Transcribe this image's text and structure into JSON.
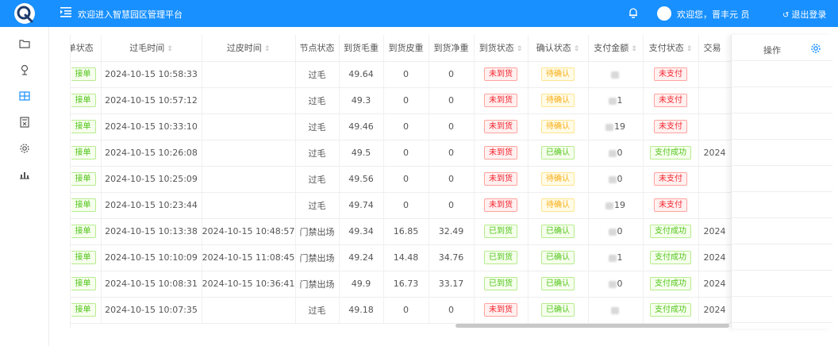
{
  "header": {
    "title": "欢迎进入智慧园区管理平台",
    "welcome": "欢迎您，晋丰元     员",
    "logout": "退出登录"
  },
  "sidebar": {
    "items": [
      {
        "icon": "folder-icon"
      },
      {
        "icon": "pin-icon"
      },
      {
        "icon": "panel-icon"
      },
      {
        "icon": "calculator-icon"
      },
      {
        "icon": "gear-icon"
      },
      {
        "icon": "chart-icon"
      }
    ]
  },
  "table": {
    "headers": {
      "order_status": "单状态",
      "gross_time": "过毛时间",
      "tare_time": "过皮时间",
      "node_status": "节点状态",
      "arrival_gross": "到货毛重",
      "arrival_tare": "到货皮重",
      "arrival_net": "到货净重",
      "arrival_status": "到货状态",
      "confirm_status": "确认状态",
      "pay_amount": "支付金额",
      "pay_status": "支付状态",
      "trade": "交易",
      "operation": "操作"
    },
    "rows": [
      {
        "order": "接单",
        "gross_time": "2024-10-15 10:58:33",
        "tare_time": "",
        "node": "过毛",
        "gross": "49.64",
        "tare": "0",
        "net": "0",
        "arrival": "未到货",
        "arrival_color": "red",
        "confirm": "待确认",
        "confirm_color": "yellow",
        "amount": "",
        "pay": "未支付",
        "pay_color": "red",
        "trade": ""
      },
      {
        "order": "接单",
        "gross_time": "2024-10-15 10:57:12",
        "tare_time": "",
        "node": "过毛",
        "gross": "49.3",
        "tare": "0",
        "net": "0",
        "arrival": "未到货",
        "arrival_color": "red",
        "confirm": "待确认",
        "confirm_color": "yellow",
        "amount": "1",
        "pay": "未支付",
        "pay_color": "red",
        "trade": ""
      },
      {
        "order": "接单",
        "gross_time": "2024-10-15 10:33:10",
        "tare_time": "",
        "node": "过毛",
        "gross": "49.46",
        "tare": "0",
        "net": "0",
        "arrival": "未到货",
        "arrival_color": "red",
        "confirm": "待确认",
        "confirm_color": "yellow",
        "amount": "19",
        "pay": "未支付",
        "pay_color": "red",
        "trade": ""
      },
      {
        "order": "接单",
        "gross_time": "2024-10-15 10:26:08",
        "tare_time": "",
        "node": "过毛",
        "gross": "49.5",
        "tare": "0",
        "net": "0",
        "arrival": "未到货",
        "arrival_color": "red",
        "confirm": "已确认",
        "confirm_color": "green",
        "amount": "0",
        "pay": "支付成功",
        "pay_color": "green",
        "trade": "2024"
      },
      {
        "order": "接单",
        "gross_time": "2024-10-15 10:25:09",
        "tare_time": "",
        "node": "过毛",
        "gross": "49.56",
        "tare": "0",
        "net": "0",
        "arrival": "未到货",
        "arrival_color": "red",
        "confirm": "待确认",
        "confirm_color": "yellow",
        "amount": "0",
        "pay": "未支付",
        "pay_color": "red",
        "trade": ""
      },
      {
        "order": "接单",
        "gross_time": "2024-10-15 10:23:44",
        "tare_time": "",
        "node": "过毛",
        "gross": "49.74",
        "tare": "0",
        "net": "0",
        "arrival": "未到货",
        "arrival_color": "red",
        "confirm": "待确认",
        "confirm_color": "yellow",
        "amount": "19",
        "pay": "未支付",
        "pay_color": "red",
        "trade": ""
      },
      {
        "order": "接单",
        "gross_time": "2024-10-15 10:13:38",
        "tare_time": "2024-10-15 10:48:57",
        "node": "门禁出场",
        "gross": "49.34",
        "tare": "16.85",
        "net": "32.49",
        "arrival": "已到货",
        "arrival_color": "green",
        "confirm": "已确认",
        "confirm_color": "green",
        "amount": "0",
        "pay": "支付成功",
        "pay_color": "green",
        "trade": "2024"
      },
      {
        "order": "接单",
        "gross_time": "2024-10-15 10:10:09",
        "tare_time": "2024-10-15 11:08:45",
        "node": "门禁出场",
        "gross": "49.24",
        "tare": "14.48",
        "net": "34.76",
        "arrival": "已到货",
        "arrival_color": "green",
        "confirm": "已确认",
        "confirm_color": "green",
        "amount": "1",
        "pay": "支付成功",
        "pay_color": "green",
        "trade": "2024"
      },
      {
        "order": "接单",
        "gross_time": "2024-10-15 10:08:31",
        "tare_time": "2024-10-15 10:36:41",
        "node": "门禁出场",
        "gross": "49.9",
        "tare": "16.73",
        "net": "33.17",
        "arrival": "已到货",
        "arrival_color": "green",
        "confirm": "已确认",
        "confirm_color": "green",
        "amount": "0",
        "pay": "支付成功",
        "pay_color": "green",
        "trade": "2024"
      },
      {
        "order": "接单",
        "gross_time": "2024-10-15 10:07:35",
        "tare_time": "",
        "node": "过毛",
        "gross": "49.18",
        "tare": "0",
        "net": "0",
        "arrival": "未到货",
        "arrival_color": "red",
        "confirm": "已确认",
        "confirm_color": "green",
        "amount": "",
        "pay": "支付成功",
        "pay_color": "green",
        "trade": "2024"
      }
    ]
  }
}
